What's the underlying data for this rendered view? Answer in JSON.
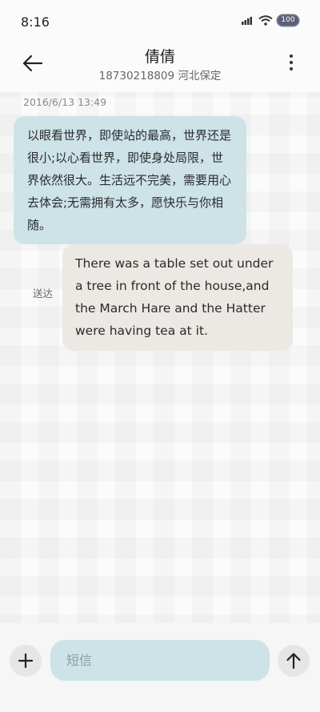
{
  "status_bar": {
    "time": "8:16",
    "battery": "100",
    "icons": [
      "volte-icon",
      "wifi-icon",
      "battery-icon"
    ]
  },
  "header": {
    "contact_name": "倩倩",
    "contact_subtitle": "18730218809 河北保定",
    "back_icon": "arrow-left-icon",
    "menu_icon": "more-vertical-icon"
  },
  "conversation": {
    "timestamp": "2016/6/13 13:49",
    "incoming_message": "以眼看世界，即使站的最高，世界还是很小;以心看世界，即使身处局限，世界依然很大。生活远不完美，需要用心去体会;无需拥有太多，愿快乐与你相随。",
    "outgoing_message": "There was a table set out under a tree in front of the house,and the March Hare and the Hatter were having tea at it.",
    "outgoing_status": "送达"
  },
  "composer": {
    "placeholder": "短信",
    "add_icon": "plus-icon",
    "send_icon": "arrow-up-icon"
  },
  "colors": {
    "incoming_bubble": "#cde3e8",
    "outgoing_bubble": "#ece8e3",
    "input_field": "#cde3e8"
  }
}
